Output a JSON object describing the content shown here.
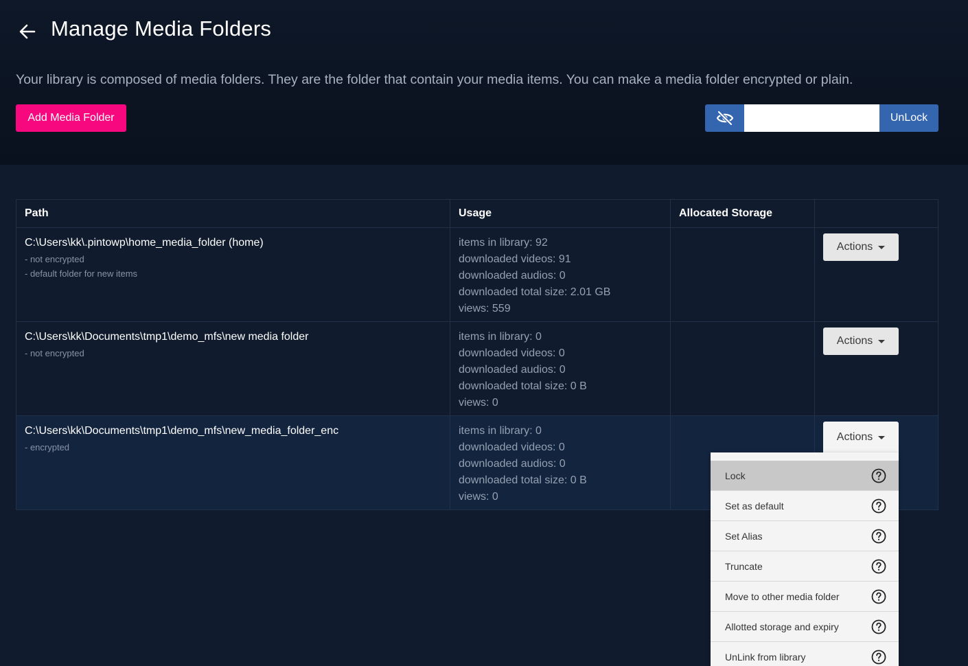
{
  "header": {
    "title": "Manage Media Folders",
    "intro": "Your library is composed of media folders. They are the folder that contain your media items. You can make a media folder encrypted or plain.",
    "add_button": "Add Media Folder",
    "unlock_button": "UnLock",
    "password_value": ""
  },
  "table": {
    "columns": [
      "Path",
      "Usage",
      "Allocated Storage",
      ""
    ],
    "rows": [
      {
        "path": "C:\\Users\\kk\\.pintowp\\home_media_folder (home)",
        "notes": [
          "- not encrypted",
          "- default folder for new items"
        ],
        "usage": [
          "items in library: 92",
          "downloaded videos: 91",
          "downloaded audios: 0",
          "downloaded total size: 2.01 GB",
          "views: 559"
        ],
        "allocated": "",
        "actions_label": "Actions"
      },
      {
        "path": "C:\\Users\\kk\\Documents\\tmp1\\demo_mfs\\new media folder",
        "notes": [
          "- not encrypted"
        ],
        "usage": [
          "items in library: 0",
          "downloaded videos: 0",
          "downloaded audios: 0",
          "downloaded total size: 0 B",
          "views: 0"
        ],
        "allocated": "",
        "actions_label": "Actions"
      },
      {
        "path": "C:\\Users\\kk\\Documents\\tmp1\\demo_mfs\\new_media_folder_enc",
        "notes": [
          "- encrypted"
        ],
        "usage": [
          "items in library: 0",
          "downloaded videos: 0",
          "downloaded audios: 0",
          "downloaded total size: 0 B",
          "views: 0"
        ],
        "allocated": "",
        "actions_label": "Actions"
      }
    ]
  },
  "actions_menu": {
    "items": [
      "Lock",
      "Set as default",
      "Set Alias",
      "Truncate",
      "Move to other media folder",
      "Allotted storage and expiry",
      "UnLink from library"
    ]
  },
  "colors": {
    "background": "#101c2e",
    "accent_pink": "#f7087f",
    "accent_blue": "#3466b0"
  },
  "icons": {
    "back": "arrow-left-icon",
    "visibility": "eye-slash-icon",
    "help": "question-circle-icon",
    "dropdown": "caret-down-icon"
  }
}
